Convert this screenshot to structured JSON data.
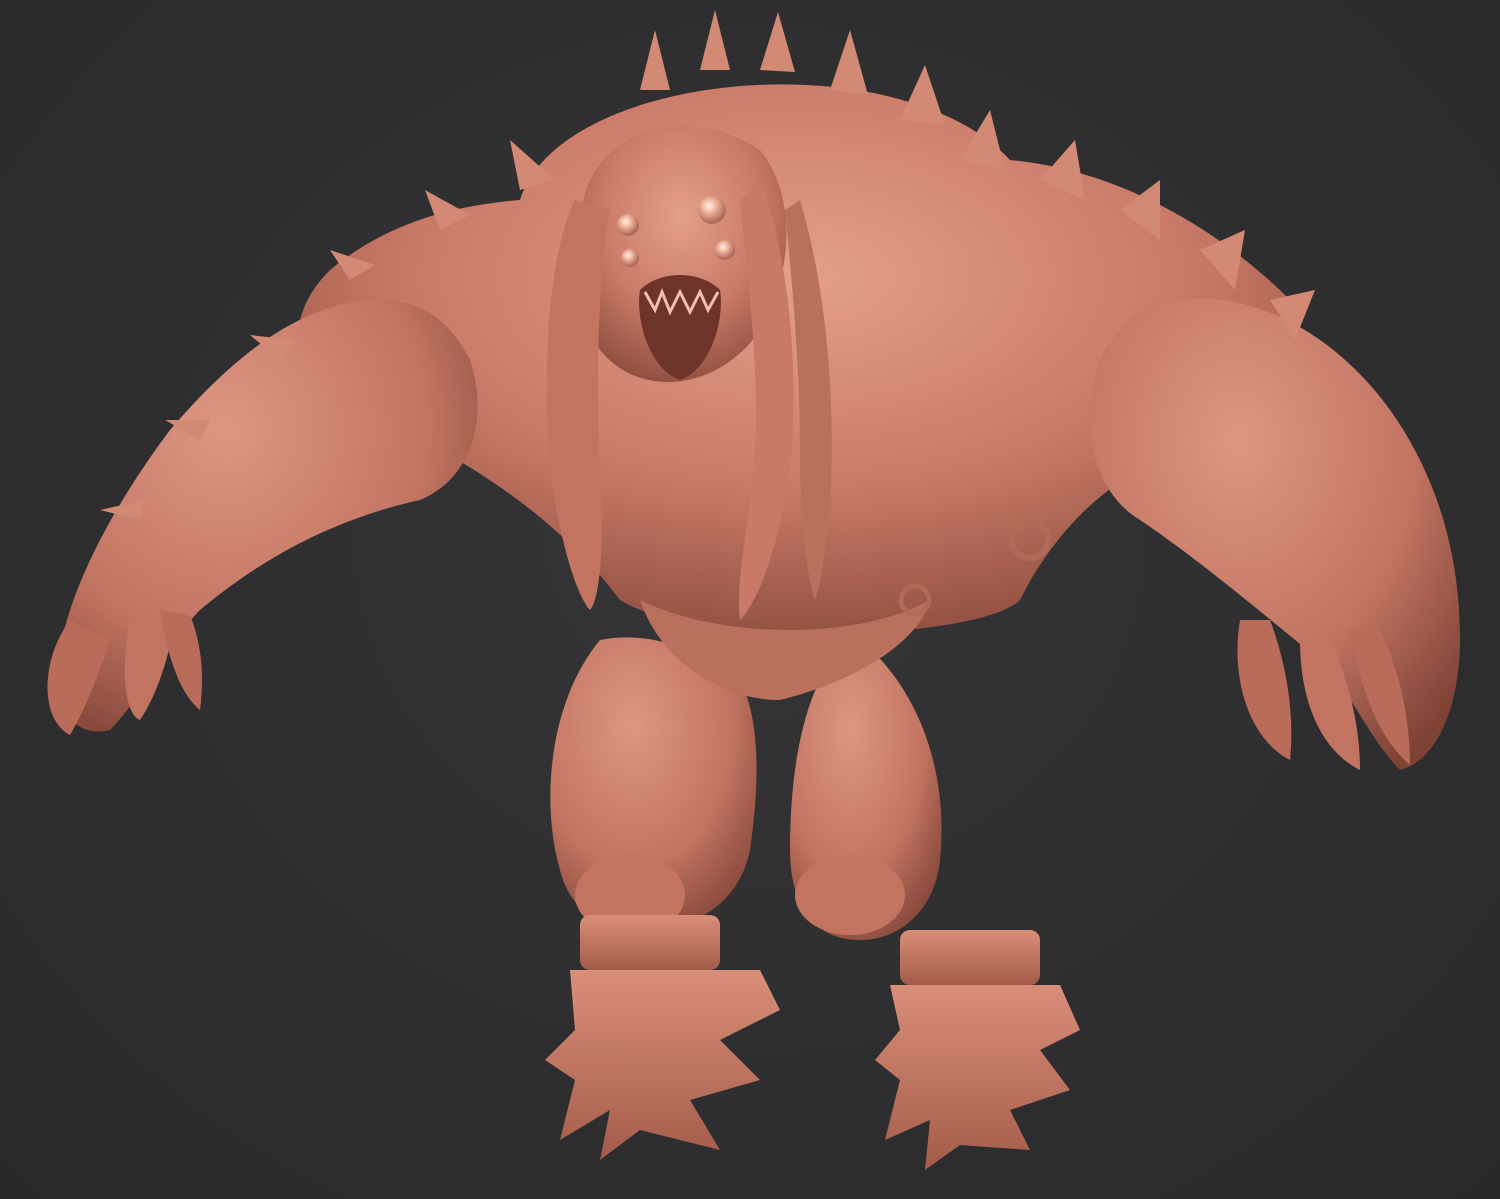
{
  "scene": {
    "background_color": "#2f2f31",
    "material_color": "#c97a66",
    "material_highlight": "#e8a792",
    "material_shadow": "#8a4a3c",
    "subject": "sculpted-creature"
  }
}
